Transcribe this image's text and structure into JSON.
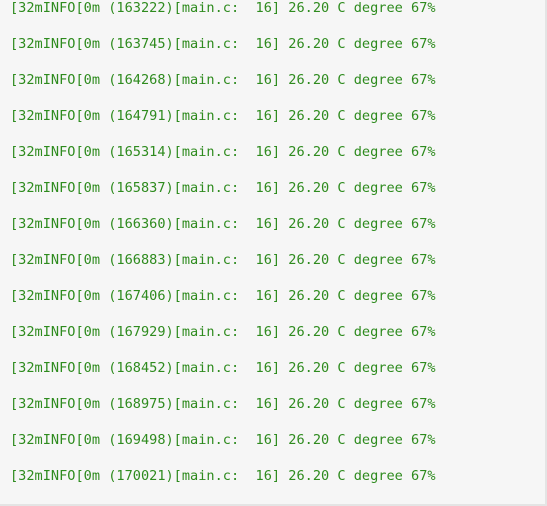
{
  "console": {
    "text_color": "#2e8b1e",
    "background_color": "#f6f6f6",
    "lines": [
      "\u0002[32mINFO\u0002[0m (163222)[main.c:  16] 26.20 C degree 67%",
      "\u0002[32mINFO\u0002[0m (163745)[main.c:  16] 26.20 C degree 67%",
      "\u0002[32mINFO\u0002[0m (164268)[main.c:  16] 26.20 C degree 67%",
      "\u0002[32mINFO\u0002[0m (164791)[main.c:  16] 26.20 C degree 67%",
      "\u0002[32mINFO\u0002[0m (165314)[main.c:  16] 26.20 C degree 67%",
      "\u0002[32mINFO\u0002[0m (165837)[main.c:  16] 26.20 C degree 67%",
      "\u0002[32mINFO\u0002[0m (166360)[main.c:  16] 26.20 C degree 67%",
      "\u0002[32mINFO\u0002[0m (166883)[main.c:  16] 26.20 C degree 67%",
      "\u0002[32mINFO\u0002[0m (167406)[main.c:  16] 26.20 C degree 67%",
      "\u0002[32mINFO\u0002[0m (167929)[main.c:  16] 26.20 C degree 67%",
      "\u0002[32mINFO\u0002[0m (168452)[main.c:  16] 26.20 C degree 67%",
      "\u0002[32mINFO\u0002[0m (168975)[main.c:  16] 26.20 C degree 67%",
      "\u0002[32mINFO\u0002[0m (169498)[main.c:  16] 26.20 C degree 67%",
      "\u0002[32mINFO\u0002[0m (170021)[main.c:  16] 26.20 C degree 67%"
    ]
  }
}
